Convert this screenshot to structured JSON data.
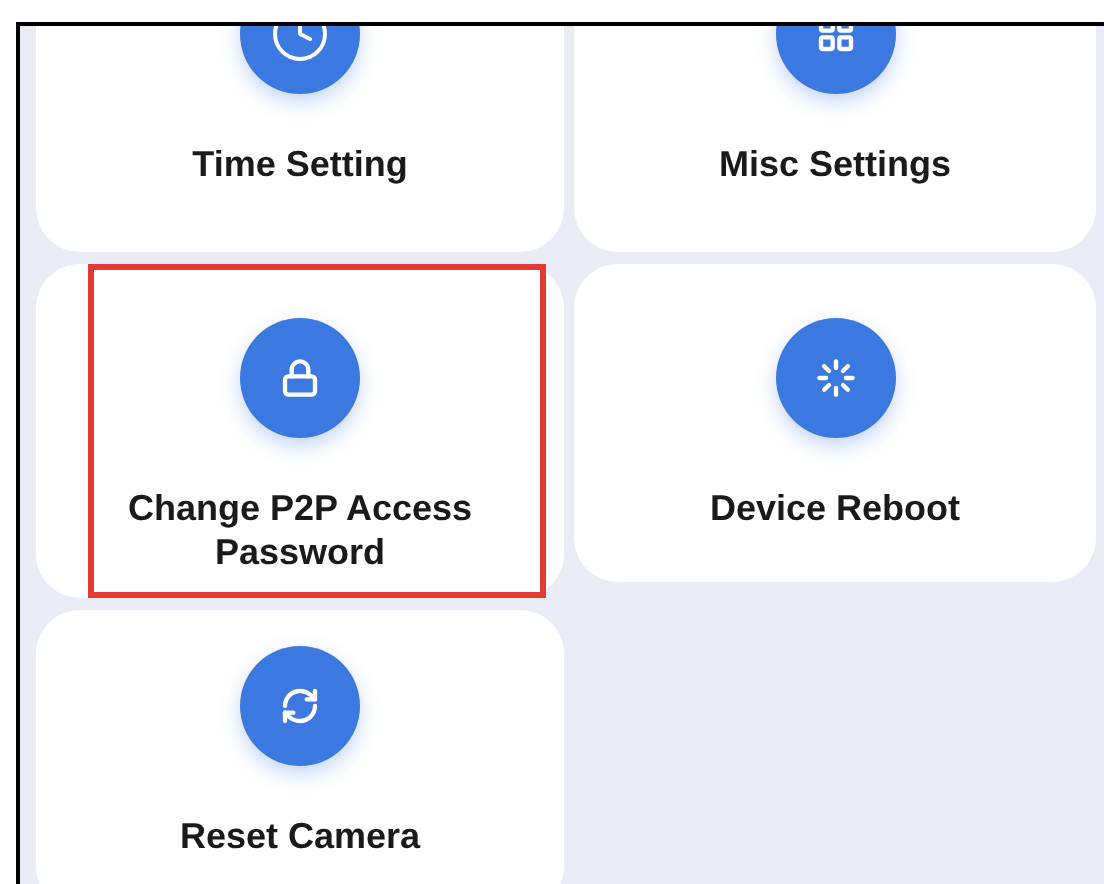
{
  "settings": [
    {
      "kind": "clock",
      "label": "Time Setting",
      "highlighted": false
    },
    {
      "kind": "apps",
      "label": "Misc Settings",
      "highlighted": false
    },
    {
      "kind": "lock",
      "label": "Change P2P Access Password",
      "highlighted": true
    },
    {
      "kind": "reboot",
      "label": "Device Reboot",
      "highlighted": false
    },
    {
      "kind": "reset",
      "label": "Reset Camera",
      "highlighted": false
    }
  ]
}
